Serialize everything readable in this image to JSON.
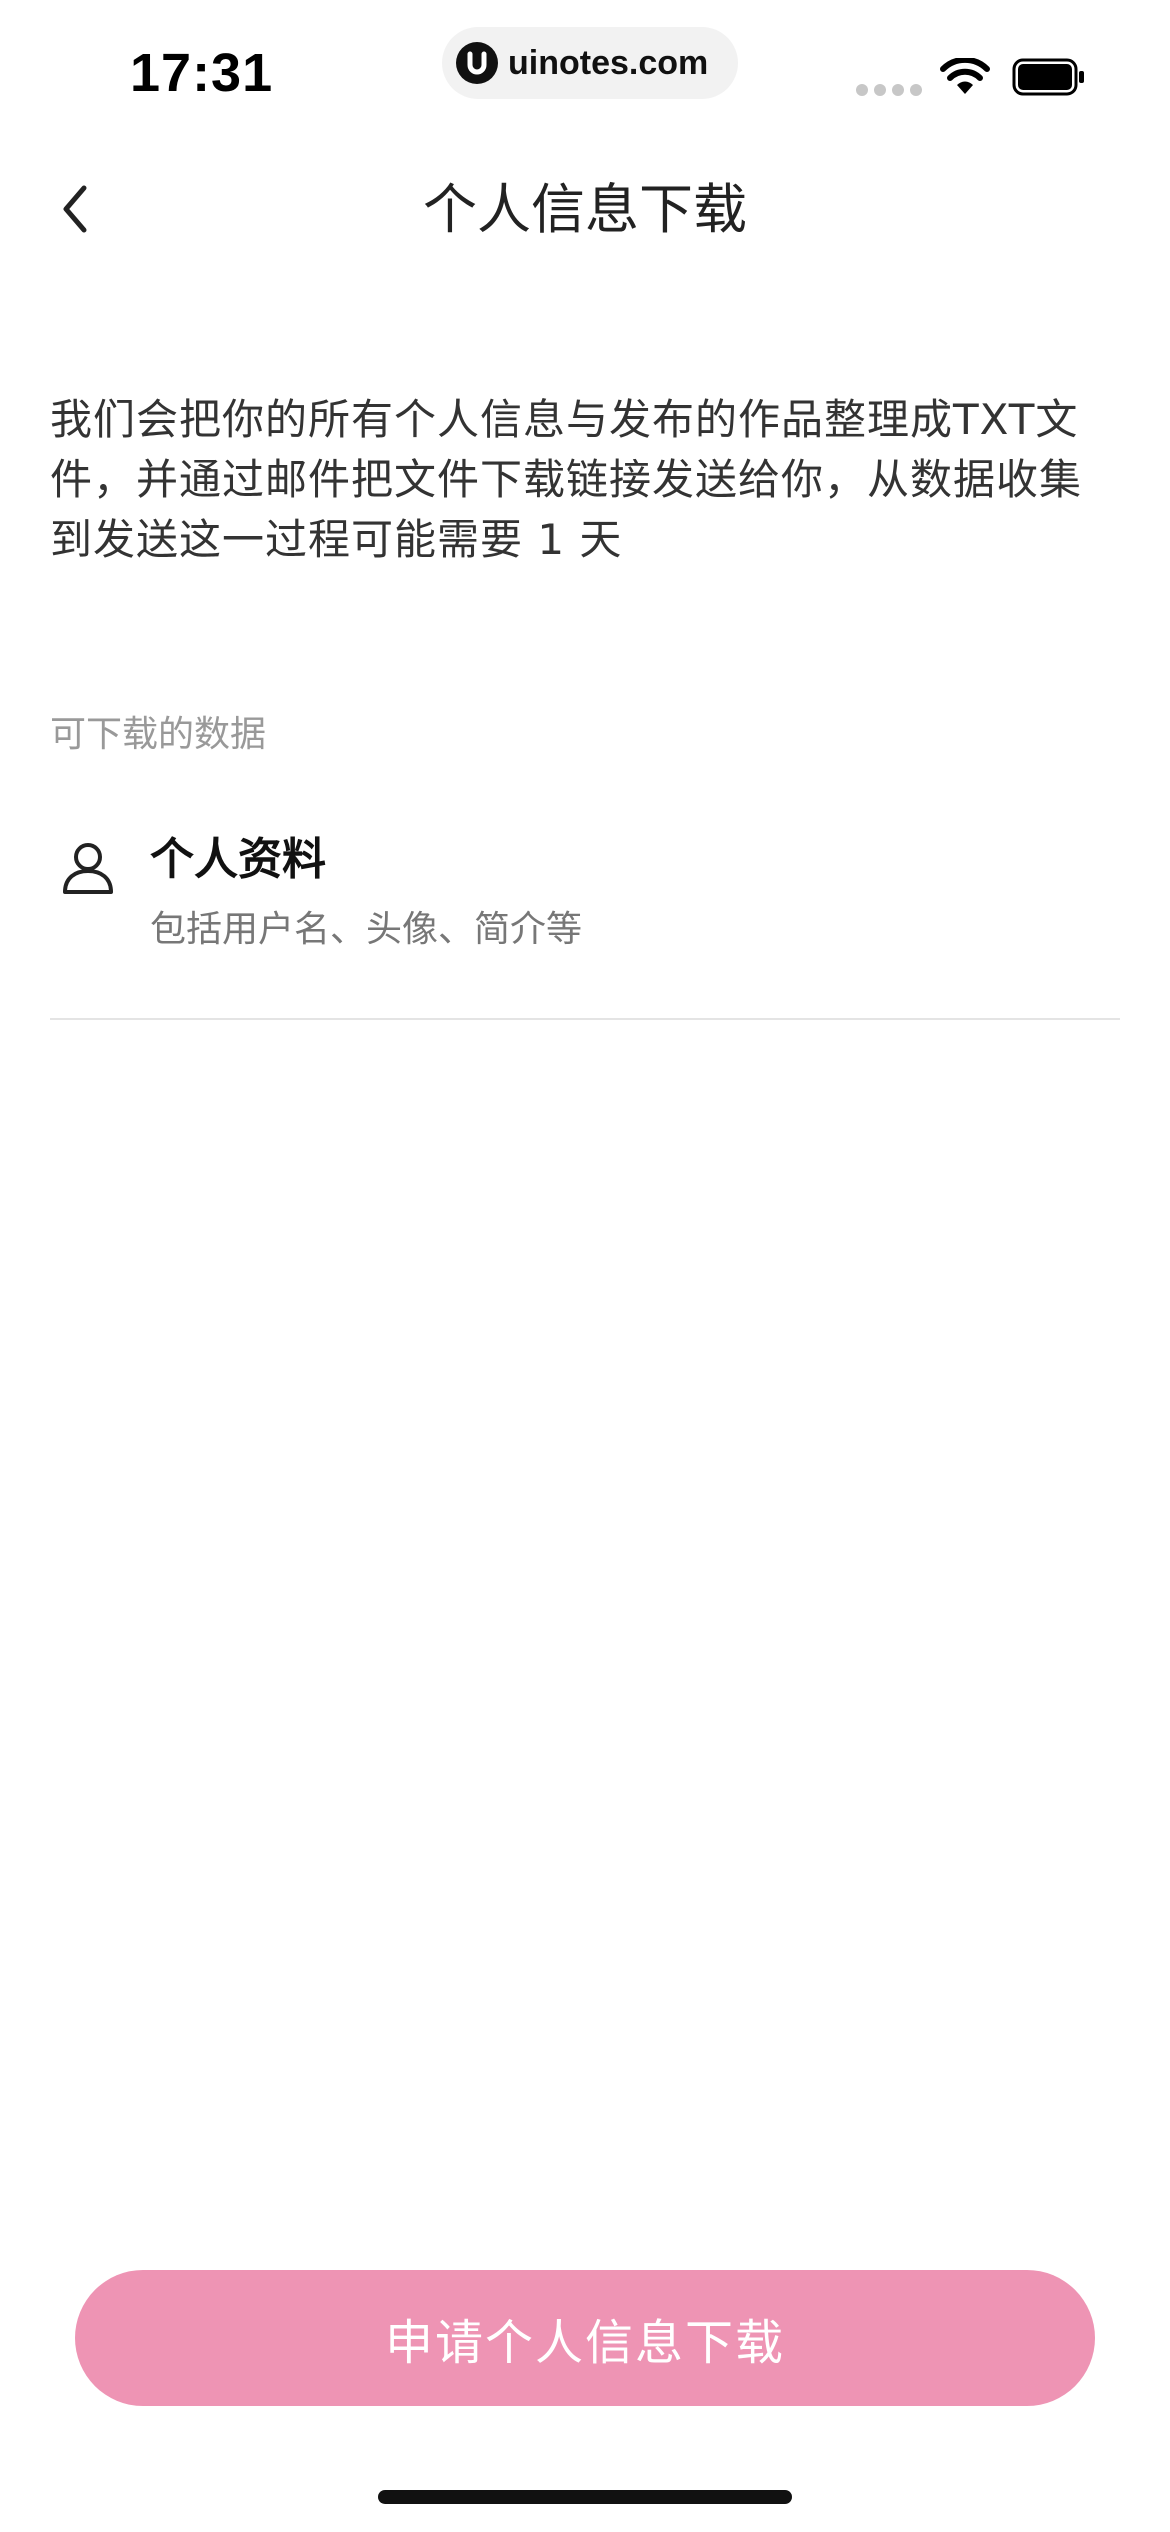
{
  "status_bar": {
    "time": "17:31",
    "url": "uinotes.com"
  },
  "nav": {
    "title": "个人信息下载",
    "back_icon": "chevron-left-icon"
  },
  "description": "我们会把你的所有个人信息与发布的作品整理成TXT文件，并通过邮件把文件下载链接发送给你，从数据收集到发送这一过程可能需要 1 天",
  "section": {
    "label": "可下载的数据",
    "items": [
      {
        "icon": "user-icon",
        "title": "个人资料",
        "subtitle": "包括用户名、头像、简介等"
      }
    ]
  },
  "apply_button": {
    "label": "申请个人信息下载",
    "color": "#ee94b4"
  }
}
